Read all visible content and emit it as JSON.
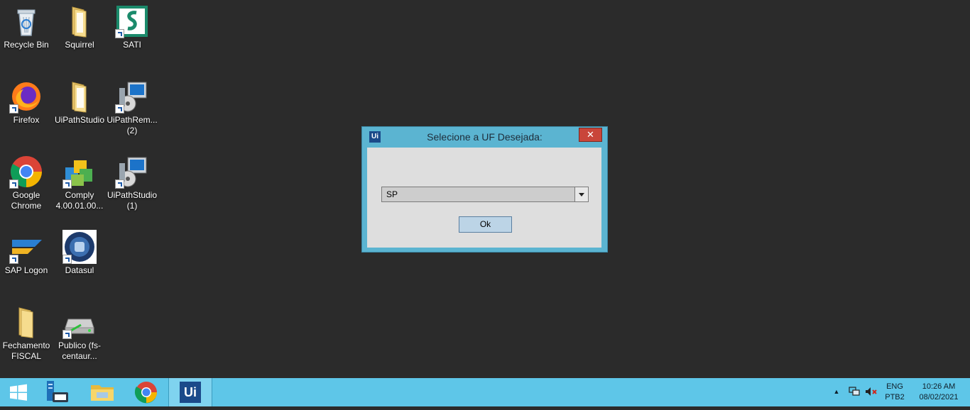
{
  "desktop": {
    "icons": [
      {
        "label": "Recycle Bin",
        "icon": "recycle-bin-icon"
      },
      {
        "label": "Squirrel",
        "icon": "folder-icon"
      },
      {
        "label": "SATI",
        "icon": "sati-icon"
      },
      {
        "label": "Firefox",
        "icon": "firefox-icon"
      },
      {
        "label": "UiPathStudio",
        "icon": "folder-icon"
      },
      {
        "label": "UiPathRem... (2)",
        "icon": "installer-icon"
      },
      {
        "label": "Google Chrome",
        "icon": "chrome-icon"
      },
      {
        "label": "Comply 4.00.01.00...",
        "icon": "comply-icon"
      },
      {
        "label": "UiPathStudio (1)",
        "icon": "installer-icon"
      },
      {
        "label": "SAP Logon",
        "icon": "sap-logon-icon"
      },
      {
        "label": "Datasul",
        "icon": "datasul-icon"
      },
      {
        "label": "Fechamento FISCAL",
        "icon": "folder-icon"
      },
      {
        "label": "Publico (fs-centaur...",
        "icon": "network-drive-icon"
      }
    ]
  },
  "dialog": {
    "logo": "Ui",
    "title": "Selecione a UF Desejada:",
    "close": "✕",
    "select_value": "SP",
    "ok_label": "Ok"
  },
  "taskbar": {
    "items": [
      "start-icon",
      "server-manager-icon",
      "file-explorer-icon",
      "chrome-icon",
      "uipath-icon"
    ],
    "uipath_label": "Ui",
    "tray": {
      "lang_top": "ENG",
      "lang_bottom": "PTB2",
      "time": "10:26 AM",
      "date": "08/02/2021",
      "chevron": "▲"
    }
  },
  "colors": {
    "desktop_bg": "#2b2b2b",
    "taskbar_bg": "#5ec6e8",
    "dialog_frame": "#5bb4d1",
    "close_red": "#c9453a"
  }
}
